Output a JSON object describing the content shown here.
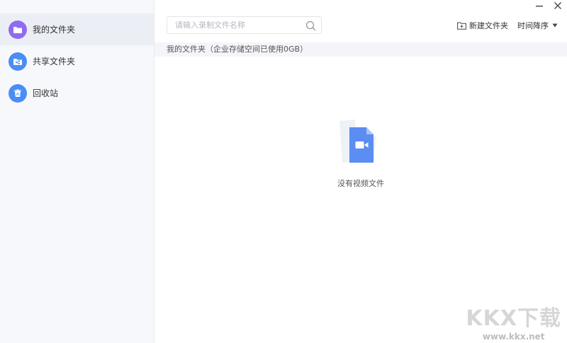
{
  "sidebar": {
    "items": [
      {
        "label": "我的文件夹",
        "icon": "folder-icon",
        "color": "#8f6bf0",
        "active": true
      },
      {
        "label": "共享文件夹",
        "icon": "shared-folder-icon",
        "color": "#4a8df5",
        "active": false
      },
      {
        "label": "回收站",
        "icon": "recycle-bin-icon",
        "color": "#4a8df5",
        "active": false
      }
    ]
  },
  "window": {
    "minimize": "minimize-icon",
    "close": "close-icon"
  },
  "search": {
    "placeholder": "请输入录制文件名称",
    "value": ""
  },
  "toolbar": {
    "new_folder": "新建文件夹",
    "sort": "时间降序"
  },
  "breadcrumb": "我的文件夹（企业存储空间已使用0GB）",
  "empty_state": {
    "text": "没有视频文件",
    "icon": "video-file-icon",
    "accent": "#5b8df2"
  },
  "watermark": {
    "logo": "KKX下载",
    "url": "www.kkx.net"
  }
}
